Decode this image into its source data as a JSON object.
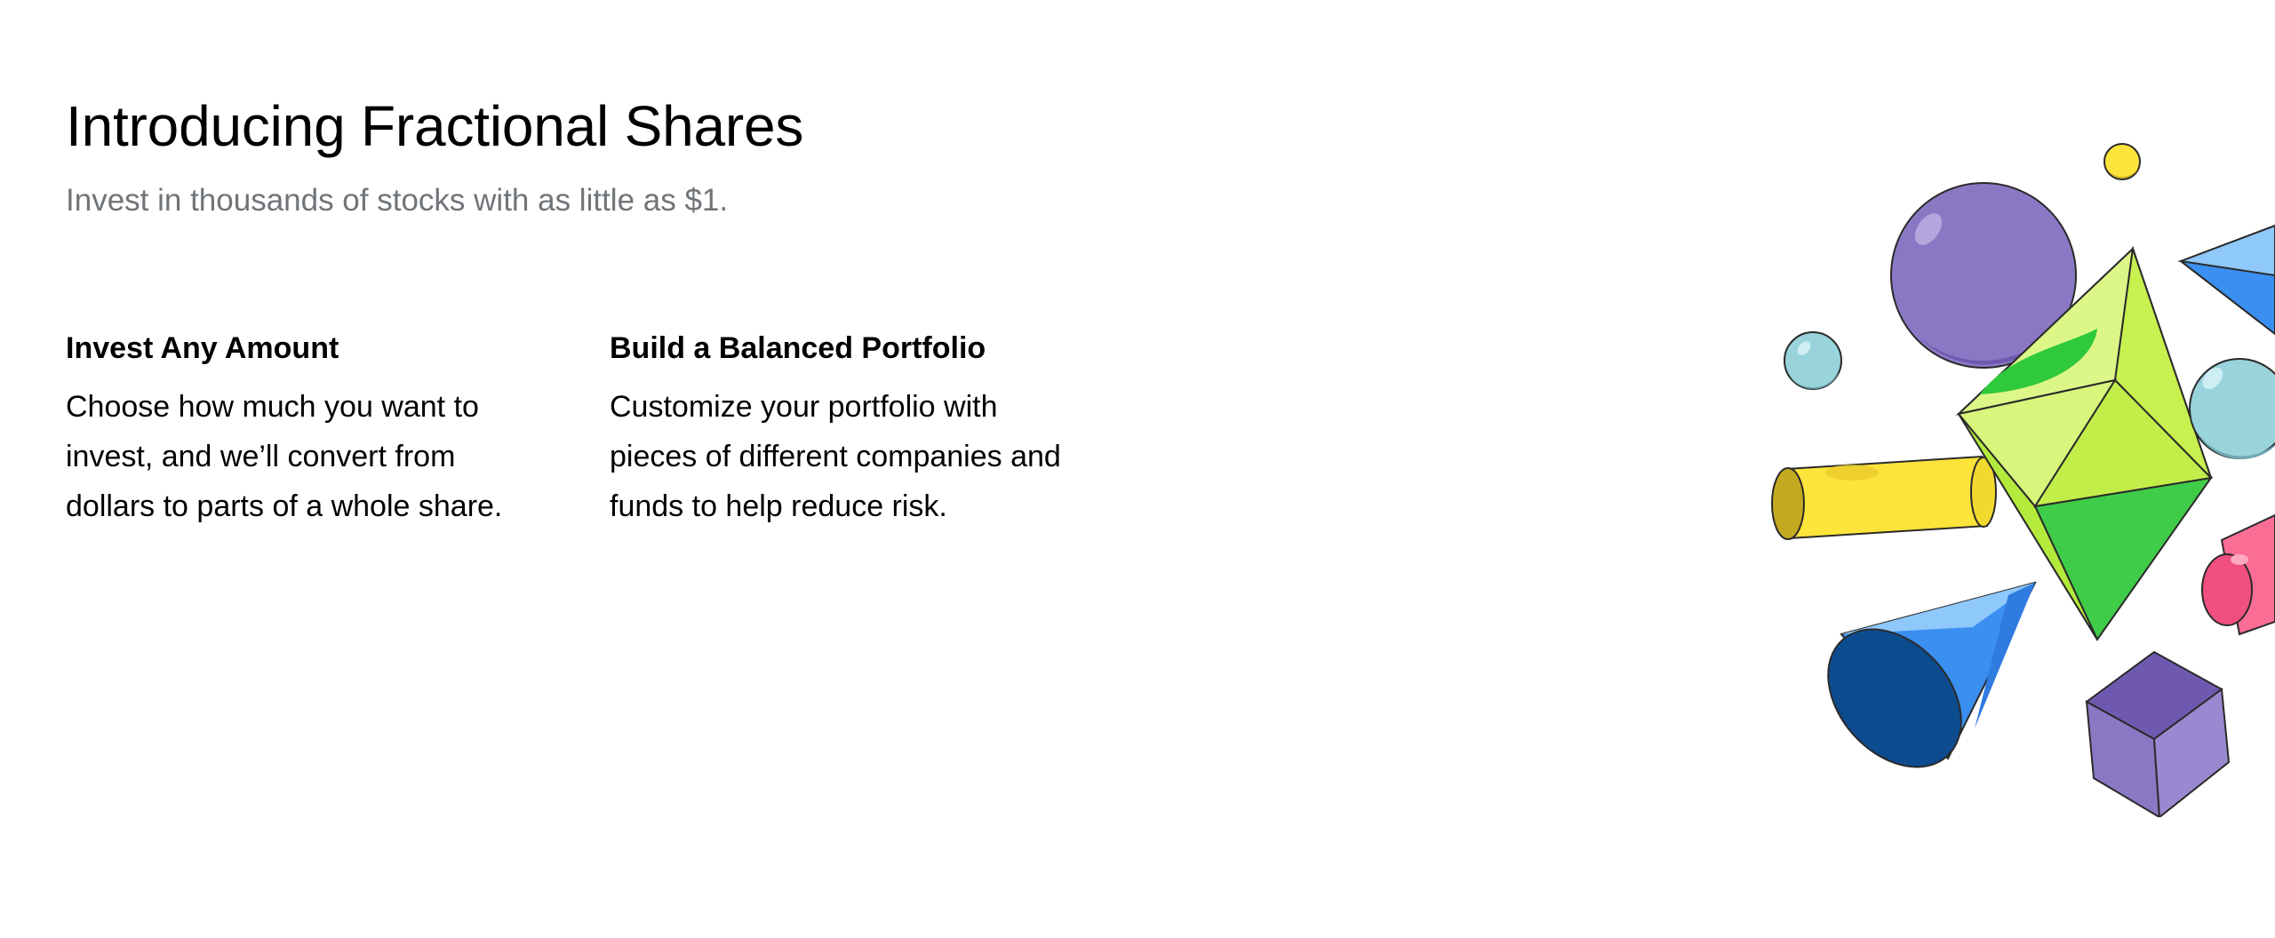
{
  "hero": {
    "title": "Introducing Fractional Shares",
    "subtitle": "Invest in thousands of stocks with as little as $1."
  },
  "features": [
    {
      "title": "Invest Any Amount",
      "body": "Choose how much you want to invest, and we’ll convert from dollars to parts of a whole share."
    },
    {
      "title": "Build a Balanced Portfolio",
      "body": "Customize your portfolio with pieces of different companies and funds to help reduce risk."
    }
  ],
  "illustration": {
    "shapes": [
      "purple-sphere",
      "yellow-sphere",
      "teal-sphere",
      "green-octahedron",
      "yellow-cylinder",
      "blue-cone",
      "purple-cube",
      "pink-cylinder",
      "blue-pyramid"
    ],
    "colors": {
      "purple": "#8b78c4",
      "green": "#c3ef48",
      "yellow": "#fde43a",
      "blue": "#3a8ff0",
      "teal": "#99d3db",
      "pink": "#fa6e96"
    }
  }
}
